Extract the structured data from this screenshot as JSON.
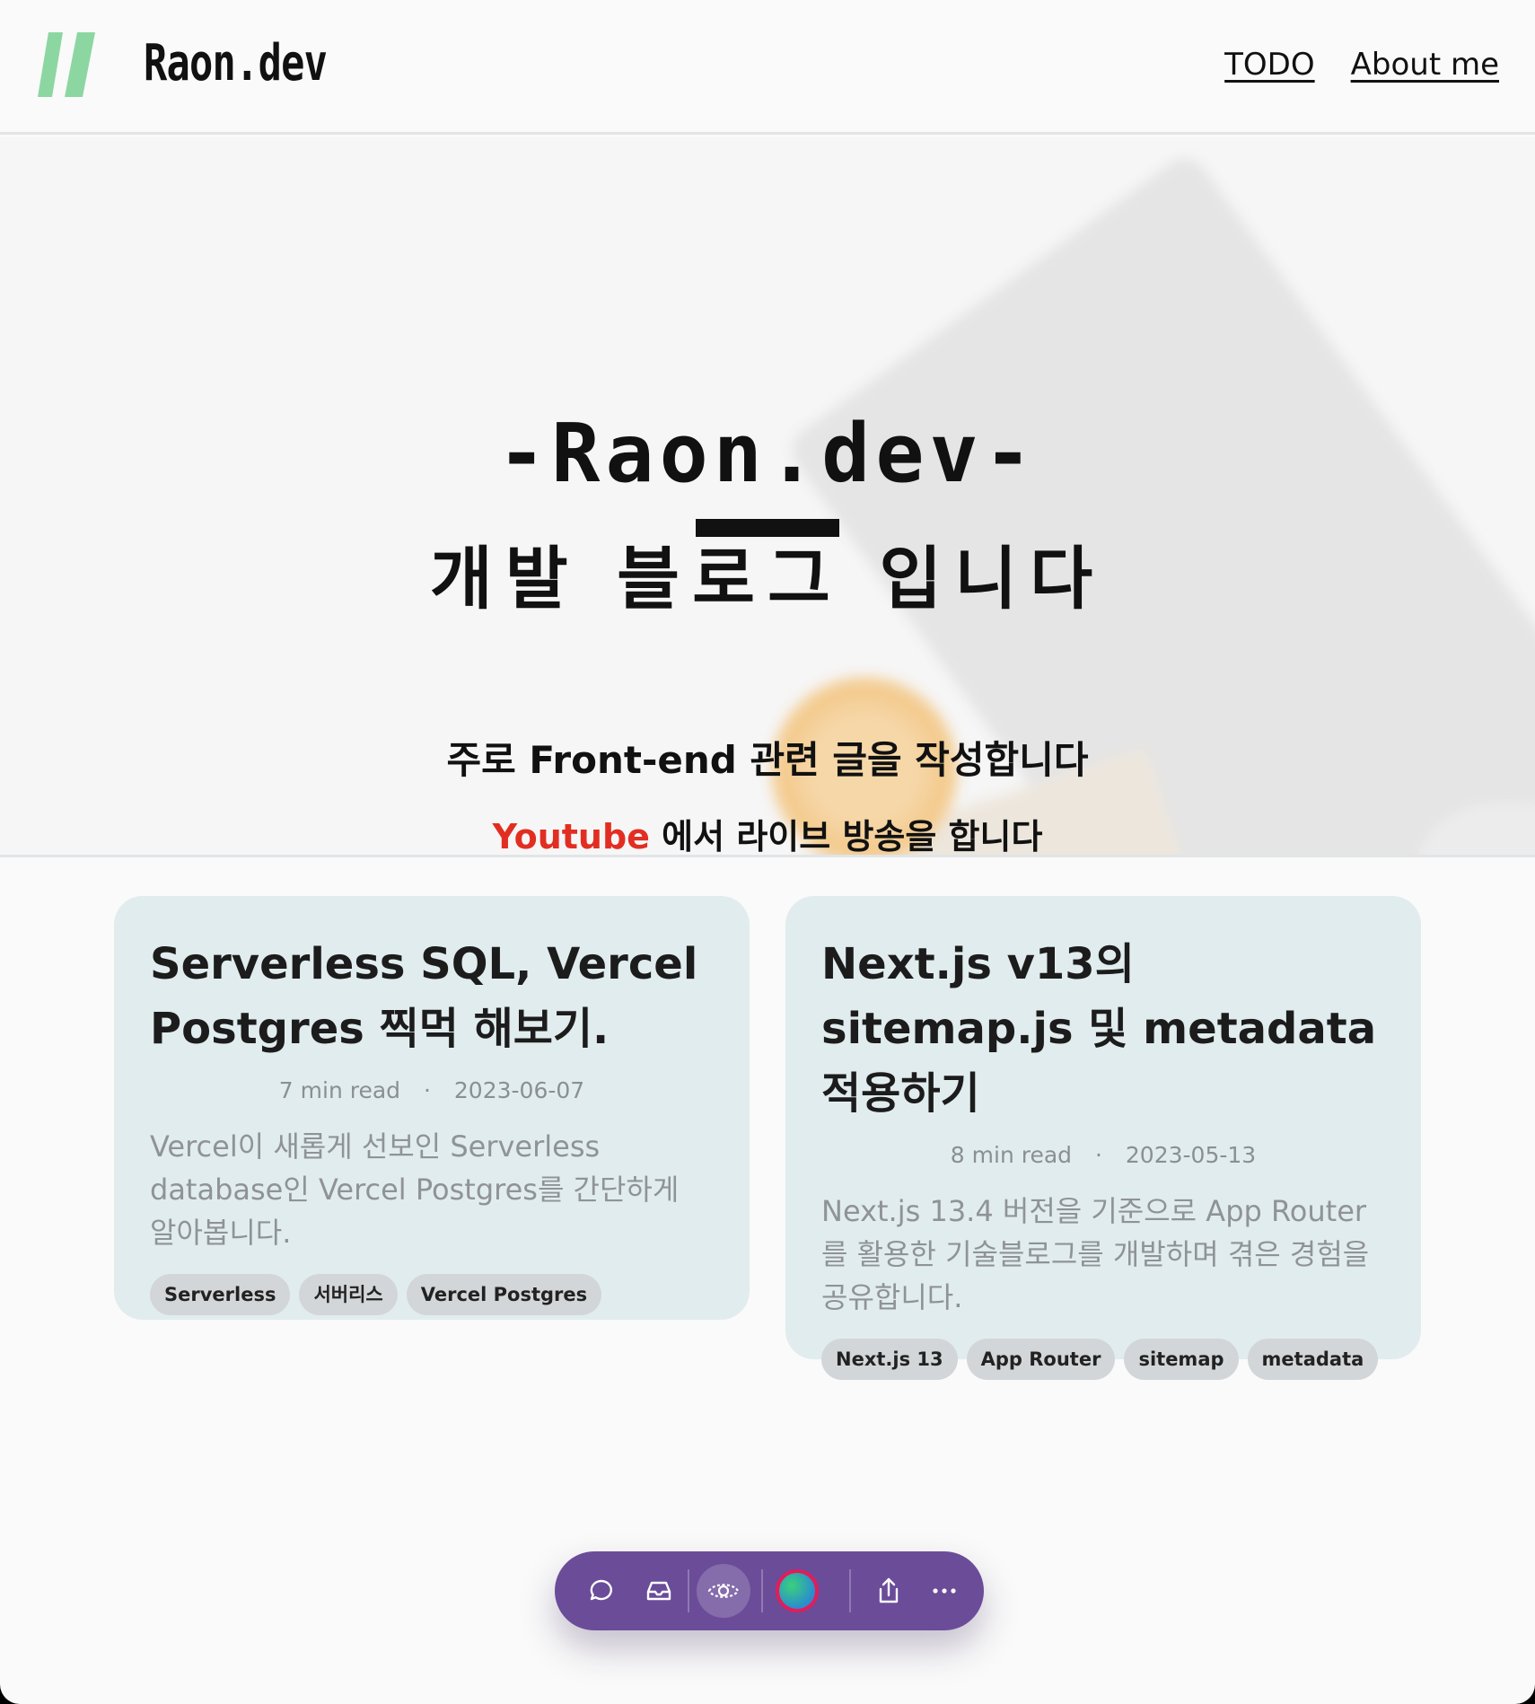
{
  "header": {
    "site_title": "Raon.dev",
    "logo_icon": "raon-logo",
    "logo_color": "#8cd6a2",
    "nav": [
      {
        "label": "TODO"
      },
      {
        "label": "About me"
      }
    ]
  },
  "hero": {
    "title": "-Raon.dev-",
    "subtitle": "개발 블로그 입니다",
    "line1": "주로 Front-end 관련 글을 작성합니다",
    "youtube_link": "Youtube",
    "line2_rest": " 에서 라이브 방송을 합니다",
    "youtube_color": "#e22e22"
  },
  "posts": [
    {
      "title": "Serverless SQL, Vercel Postgres 찍먹 해보기.",
      "read_time": "7 min read",
      "separator": "·",
      "date": "2023-06-07",
      "description": "Vercel이 새롭게 선보인 Serverless database인 Vercel Postgres를 간단하게 알아봅니다.",
      "tags": [
        "Serverless",
        "서버리스",
        "Vercel Postgres"
      ]
    },
    {
      "title": "Next.js v13의 sitemap.js 및 metadata 적용하기",
      "read_time": "8 min read",
      "separator": "·",
      "date": "2023-05-13",
      "description": "Next.js 13.4 버전을 기준으로 App Router를 활용한 기술블로그를 개발하며 겪은 경험을 공유합니다.",
      "tags": [
        "Next.js 13",
        "App Router",
        "sitemap",
        "metadata"
      ]
    }
  ],
  "toolbar": {
    "color": "#6b4c99",
    "items": [
      "comment-icon",
      "inbox-icon",
      "preview-eye-icon",
      "avatar",
      "share-icon",
      "more-icon"
    ]
  }
}
